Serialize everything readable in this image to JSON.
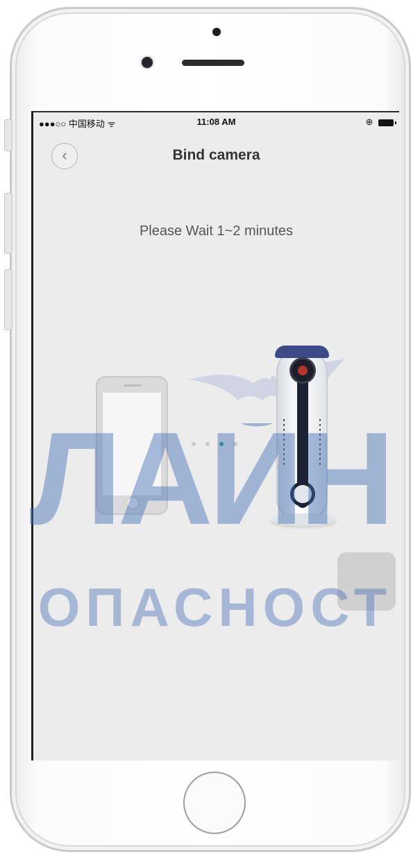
{
  "status_bar": {
    "carrier": "●●●○○ 中国移动 ᯤ",
    "time": "11:08 AM",
    "right_icons": "⊕"
  },
  "nav": {
    "back_glyph": "‹",
    "title": "Bind camera"
  },
  "message": "Please Wait 1~2 minutes",
  "progress_dots": {
    "count": 4,
    "active_index": 2,
    "active_color": "#3b9a86"
  },
  "watermark": {
    "line1": "ЛАЙН",
    "line2": "ОПАСНОСТ"
  },
  "icons": [
    "back-chevron-icon",
    "wifi-icon",
    "battery-icon",
    "phone-illustration-icon",
    "camera-illustration-icon",
    "bat-logo-icon",
    "home-button-icon"
  ]
}
